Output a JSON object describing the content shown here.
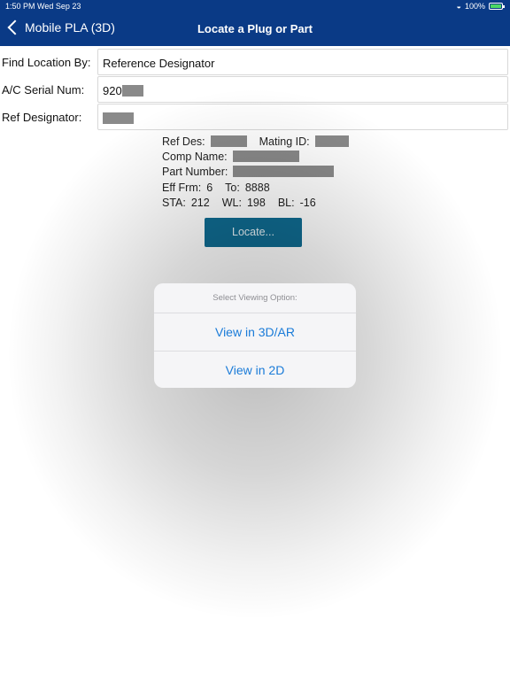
{
  "status_bar": {
    "time": "1:50 PM  Wed Sep 23",
    "battery_percent": "100%",
    "battery_level": 1.0,
    "wifi_icon": "wifi-icon"
  },
  "nav": {
    "back_label": "Mobile PLA (3D)",
    "title": "Locate a Plug or Part"
  },
  "form": {
    "find_location_by": {
      "label": "Find Location By:",
      "value": "Reference Designator"
    },
    "serial_num": {
      "label": "A/C Serial Num:",
      "value": "920"
    },
    "ref_designator": {
      "label": "Ref Designator:",
      "value": ""
    }
  },
  "details": {
    "ref_des_label": "Ref Des:",
    "mating_id_label": "Mating ID:",
    "comp_name_label": "Comp Name:",
    "part_number_label": "Part Number:",
    "eff_frm_label": "Eff Frm:",
    "eff_frm_value": "6",
    "to_label": "To:",
    "to_value": "8888",
    "sta_label": "STA:",
    "sta_value": "212",
    "wl_label": "WL:",
    "wl_value": "198",
    "bl_label": "BL:",
    "bl_value": "-16"
  },
  "locate_button": "Locate...",
  "popover": {
    "title": "Select Viewing Option:",
    "options": [
      "View in 3D/AR",
      "View in 2D"
    ]
  },
  "colors": {
    "nav_bg": "#0a3a86",
    "button_bg": "#0f6c92",
    "option_text": "#1a7bd8"
  }
}
